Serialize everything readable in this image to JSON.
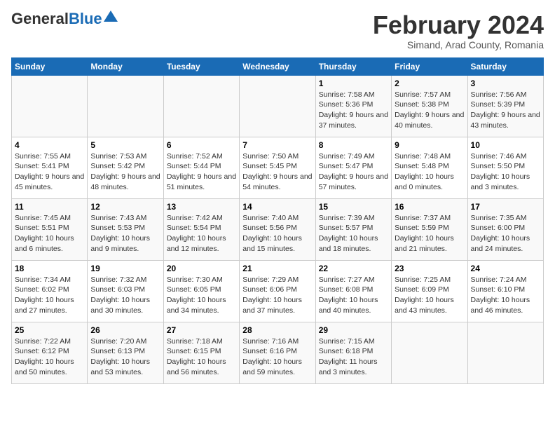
{
  "header": {
    "logo_general": "General",
    "logo_blue": "Blue",
    "month_title": "February 2024",
    "subtitle": "Simand, Arad County, Romania"
  },
  "days_of_week": [
    "Sunday",
    "Monday",
    "Tuesday",
    "Wednesday",
    "Thursday",
    "Friday",
    "Saturday"
  ],
  "weeks": [
    [
      {
        "day": "",
        "info": ""
      },
      {
        "day": "",
        "info": ""
      },
      {
        "day": "",
        "info": ""
      },
      {
        "day": "",
        "info": ""
      },
      {
        "day": "1",
        "info": "Sunrise: 7:58 AM\nSunset: 5:36 PM\nDaylight: 9 hours and 37 minutes."
      },
      {
        "day": "2",
        "info": "Sunrise: 7:57 AM\nSunset: 5:38 PM\nDaylight: 9 hours and 40 minutes."
      },
      {
        "day": "3",
        "info": "Sunrise: 7:56 AM\nSunset: 5:39 PM\nDaylight: 9 hours and 43 minutes."
      }
    ],
    [
      {
        "day": "4",
        "info": "Sunrise: 7:55 AM\nSunset: 5:41 PM\nDaylight: 9 hours and 45 minutes."
      },
      {
        "day": "5",
        "info": "Sunrise: 7:53 AM\nSunset: 5:42 PM\nDaylight: 9 hours and 48 minutes."
      },
      {
        "day": "6",
        "info": "Sunrise: 7:52 AM\nSunset: 5:44 PM\nDaylight: 9 hours and 51 minutes."
      },
      {
        "day": "7",
        "info": "Sunrise: 7:50 AM\nSunset: 5:45 PM\nDaylight: 9 hours and 54 minutes."
      },
      {
        "day": "8",
        "info": "Sunrise: 7:49 AM\nSunset: 5:47 PM\nDaylight: 9 hours and 57 minutes."
      },
      {
        "day": "9",
        "info": "Sunrise: 7:48 AM\nSunset: 5:48 PM\nDaylight: 10 hours and 0 minutes."
      },
      {
        "day": "10",
        "info": "Sunrise: 7:46 AM\nSunset: 5:50 PM\nDaylight: 10 hours and 3 minutes."
      }
    ],
    [
      {
        "day": "11",
        "info": "Sunrise: 7:45 AM\nSunset: 5:51 PM\nDaylight: 10 hours and 6 minutes."
      },
      {
        "day": "12",
        "info": "Sunrise: 7:43 AM\nSunset: 5:53 PM\nDaylight: 10 hours and 9 minutes."
      },
      {
        "day": "13",
        "info": "Sunrise: 7:42 AM\nSunset: 5:54 PM\nDaylight: 10 hours and 12 minutes."
      },
      {
        "day": "14",
        "info": "Sunrise: 7:40 AM\nSunset: 5:56 PM\nDaylight: 10 hours and 15 minutes."
      },
      {
        "day": "15",
        "info": "Sunrise: 7:39 AM\nSunset: 5:57 PM\nDaylight: 10 hours and 18 minutes."
      },
      {
        "day": "16",
        "info": "Sunrise: 7:37 AM\nSunset: 5:59 PM\nDaylight: 10 hours and 21 minutes."
      },
      {
        "day": "17",
        "info": "Sunrise: 7:35 AM\nSunset: 6:00 PM\nDaylight: 10 hours and 24 minutes."
      }
    ],
    [
      {
        "day": "18",
        "info": "Sunrise: 7:34 AM\nSunset: 6:02 PM\nDaylight: 10 hours and 27 minutes."
      },
      {
        "day": "19",
        "info": "Sunrise: 7:32 AM\nSunset: 6:03 PM\nDaylight: 10 hours and 30 minutes."
      },
      {
        "day": "20",
        "info": "Sunrise: 7:30 AM\nSunset: 6:05 PM\nDaylight: 10 hours and 34 minutes."
      },
      {
        "day": "21",
        "info": "Sunrise: 7:29 AM\nSunset: 6:06 PM\nDaylight: 10 hours and 37 minutes."
      },
      {
        "day": "22",
        "info": "Sunrise: 7:27 AM\nSunset: 6:08 PM\nDaylight: 10 hours and 40 minutes."
      },
      {
        "day": "23",
        "info": "Sunrise: 7:25 AM\nSunset: 6:09 PM\nDaylight: 10 hours and 43 minutes."
      },
      {
        "day": "24",
        "info": "Sunrise: 7:24 AM\nSunset: 6:10 PM\nDaylight: 10 hours and 46 minutes."
      }
    ],
    [
      {
        "day": "25",
        "info": "Sunrise: 7:22 AM\nSunset: 6:12 PM\nDaylight: 10 hours and 50 minutes."
      },
      {
        "day": "26",
        "info": "Sunrise: 7:20 AM\nSunset: 6:13 PM\nDaylight: 10 hours and 53 minutes."
      },
      {
        "day": "27",
        "info": "Sunrise: 7:18 AM\nSunset: 6:15 PM\nDaylight: 10 hours and 56 minutes."
      },
      {
        "day": "28",
        "info": "Sunrise: 7:16 AM\nSunset: 6:16 PM\nDaylight: 10 hours and 59 minutes."
      },
      {
        "day": "29",
        "info": "Sunrise: 7:15 AM\nSunset: 6:18 PM\nDaylight: 11 hours and 3 minutes."
      },
      {
        "day": "",
        "info": ""
      },
      {
        "day": "",
        "info": ""
      }
    ]
  ]
}
